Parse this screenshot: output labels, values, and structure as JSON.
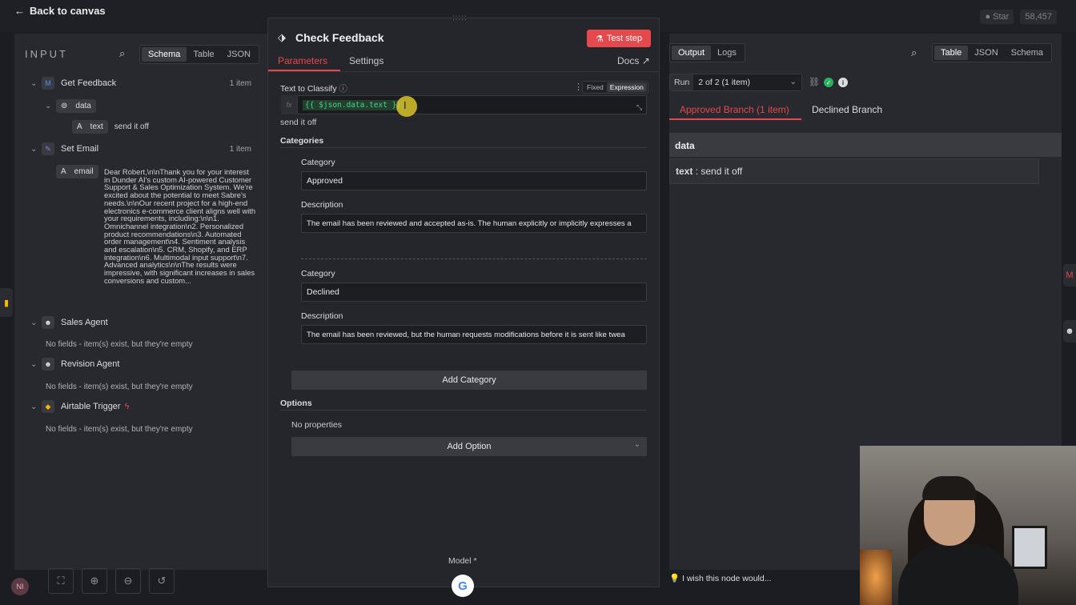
{
  "top": {
    "back_label": "Back to canvas",
    "star_label": "Star",
    "star_count": "58,457"
  },
  "input": {
    "title": "INPUT",
    "views": [
      "Schema",
      "Table",
      "JSON"
    ],
    "nodes": [
      {
        "name": "Get Feedback",
        "count": "1 item"
      },
      {
        "name": "Set Email",
        "count": "1 item"
      },
      {
        "name": "Sales Agent",
        "empty": "No fields - item(s) exist, but they're empty"
      },
      {
        "name": "Revision Agent",
        "empty": "No fields - item(s) exist, but they're empty"
      },
      {
        "name": "Airtable Trigger",
        "empty": "No fields - item(s) exist, but they're empty"
      }
    ],
    "data_field": "data",
    "text_field": "text",
    "text_value": "send it off",
    "email_field": "email",
    "email_value": "Dear Robert,\\n\\nThank you for your interest in Dunder AI's custom AI-powered Customer Support & Sales Optimization System. We're excited about the potential to meet Sabre's needs.\\n\\nOur recent project for a high-end electronics e-commerce client aligns well with your requirements, including:\\n\\n1. Omnichannel integration\\n2. Personalized product recommendations\\n3. Automated order management\\n4. Sentiment analysis and escalation\\n5. CRM, Shopify, and ERP integration\\n6. Multimodal input support\\n7. Advanced analytics\\n\\nThe results were impressive, with significant increases in sales conversions and custom..."
  },
  "node": {
    "title": "Check Feedback",
    "test_label": "Test step",
    "tabs": [
      "Parameters",
      "Settings"
    ],
    "docs_label": "Docs",
    "text_to_classify_label": "Text to Classify",
    "fixed_label": "Fixed",
    "expression_label": "Expression",
    "fx": "fx",
    "expression": "{{ $json.data.text }}",
    "expression_result": "send it off",
    "categories_label": "Categories",
    "category_label": "Category",
    "description_label": "Description",
    "categories": [
      {
        "name": "Approved",
        "description": "The email has been reviewed and accepted as-is. The human explicitly or implicitly expresses a"
      },
      {
        "name": "Declined",
        "description": "The email has been reviewed, but the human requests modifications before it is sent like twea"
      }
    ],
    "add_category": "Add Category",
    "options_label": "Options",
    "no_properties": "No properties",
    "add_option": "Add Option",
    "model_label": "Model *"
  },
  "output": {
    "tabs": [
      "Output",
      "Logs"
    ],
    "views": [
      "Table",
      "JSON",
      "Schema"
    ],
    "run_label": "Run",
    "run_value": "2 of 2 (1 item)",
    "branches": [
      "Approved Branch (1 item)",
      "Declined Branch"
    ],
    "data_header": "data",
    "row_key": "text",
    "row_value": ": send it off"
  },
  "footer": {
    "wish": "I wish this node would..."
  },
  "colors": {
    "accent": "#e5484d",
    "expression_green": "#49d18a",
    "cursor_yellow": "#d8c22a"
  }
}
